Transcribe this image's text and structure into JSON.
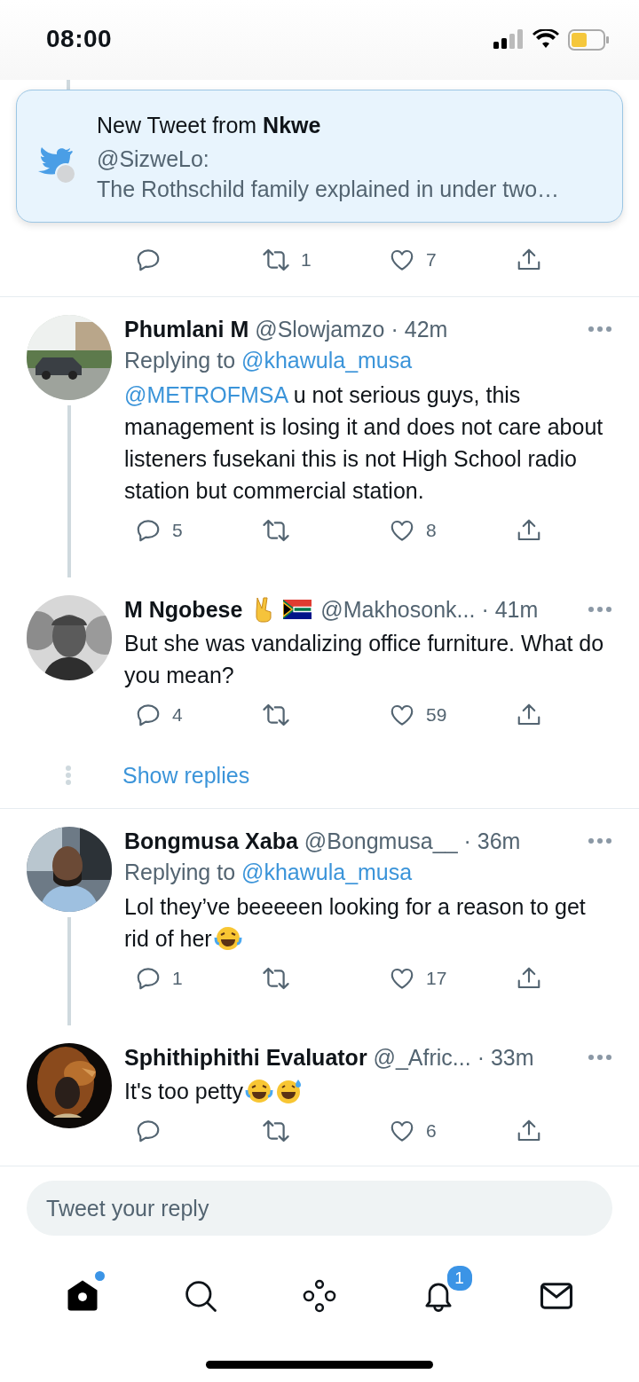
{
  "status_bar": {
    "time": "08:00"
  },
  "notification": {
    "title": "New Tweet from **Nkwe**",
    "handle": "@SizweLo:",
    "text": "The Rothschild family explained in under two…"
  },
  "previous_tweet": {
    "actions": {
      "retweets": "1",
      "likes": "7"
    }
  },
  "threads": [
    {
      "tweets": [
        {
          "name": "Phumlani M",
          "handle": "@Slowjamzo",
          "time": "· 42m",
          "replying_prefix": "Replying to",
          "replying_to": "@khawula_musa",
          "mention": "@METROFMSA",
          "text": "u not serious guys, this management is losing it and does not care about listeners fusekani this is not High School radio station but commercial station.",
          "connected": true,
          "actions": {
            "replies": "5",
            "likes": "8"
          }
        },
        {
          "name": "M Ngobese",
          "badges": [
            {
              "kind": "victory"
            },
            {
              "kind": "flag"
            }
          ],
          "handle": "@Makhosonk...",
          "time": "· 41m",
          "text": "But she was vandalizing office furniture. What do you mean?",
          "connected": false,
          "actions": {
            "replies": "4",
            "likes": "59"
          }
        }
      ],
      "show_replies": "Show replies"
    },
    {
      "tweets": [
        {
          "name": "Bongmusa Xaba",
          "handle": "@Bongmusa__",
          "time": "· 36m",
          "replying_prefix": "Replying to",
          "replying_to": "@khawula_musa",
          "text": "Lol they’ve beeeeen looking for a reason to get rid of her",
          "emojis": [
            {
              "kind": "tears-of-joy"
            }
          ],
          "connected": true,
          "actions": {
            "replies": "1",
            "likes": "17"
          }
        },
        {
          "name": "Sphithiphithi Evaluator",
          "handle": "@_Afric...",
          "time": "· 33m",
          "text": "It's too petty",
          "emojis": [
            {
              "kind": "tears-of-joy"
            },
            {
              "kind": "sweat-smile"
            }
          ],
          "connected": false,
          "actions": {
            "likes": "6"
          }
        }
      ]
    }
  ],
  "reply_field": {
    "placeholder": "Tweet your reply"
  },
  "nav": [
    {
      "kind": "home",
      "selected": true,
      "dot": true
    },
    {
      "kind": "search",
      "selected": false
    },
    {
      "kind": "spaces",
      "selected": false
    },
    {
      "kind": "notifications",
      "selected": false,
      "badge": "1"
    },
    {
      "kind": "messages",
      "selected": false
    }
  ]
}
